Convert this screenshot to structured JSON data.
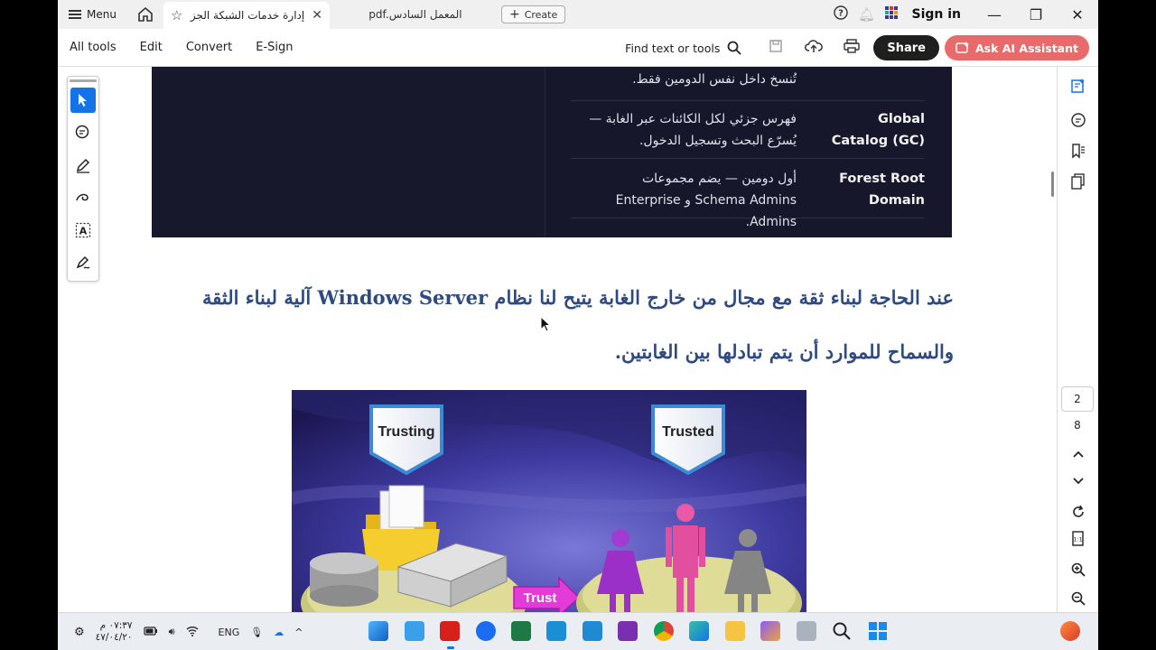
{
  "titlebar": {
    "menu_label": "Menu",
    "active_tab_title": "إدارة خدمات الشبكة  الجزء ..",
    "second_tab_title": "pdf.المعمل السادس",
    "create_label": "Create",
    "sign_in_label": "Sign in"
  },
  "toolbar": {
    "items": [
      "All tools",
      "Edit",
      "Convert",
      "E-Sign"
    ],
    "find_label": "Find text or tools",
    "share_label": "Share",
    "ai_label": "Ask AI Assistant"
  },
  "doc": {
    "top_fragment": "تُنسخ داخل نفس الدومين فقط.",
    "rows": [
      {
        "term_line1": "Global",
        "term_line2": "Catalog (GC)",
        "desc_line1": "فهرس جزئي لكل الكائنات عبر الغابة —",
        "desc_line2": "يُسرّع البحث وتسجيل الدخول."
      },
      {
        "term_line1": "Forest Root",
        "term_line2": "Domain",
        "desc_line1": "أول دومين — يضم مجموعات",
        "desc_line2": "Schema Admins و Enterprise Admins."
      }
    ],
    "paragraph": "عند الحاجة لبناء ثقة مع مجال من خارج الغابة يتيح لنا نظام Windows Server آلية لبناء الثقة والسماح للموارد أن يتم تبادلها بين الغابتين.",
    "figure": {
      "trusting_label": "Trusting",
      "trusted_label": "Trusted",
      "trust_label": "Trust"
    }
  },
  "right_rail": {
    "current_page": "2",
    "total_pages": "8"
  },
  "taskbar": {
    "time": "٠٧:٣٧ م",
    "date": "٤٧/٠٤/٢٠",
    "lang": "ENG"
  },
  "colors": {
    "accent_blue": "#1473e6",
    "share_bg": "#1f1f1f",
    "ai_bg": "#e86a6a",
    "paragraph_text": "#2f4a80",
    "dark_panel": "#16172a"
  }
}
